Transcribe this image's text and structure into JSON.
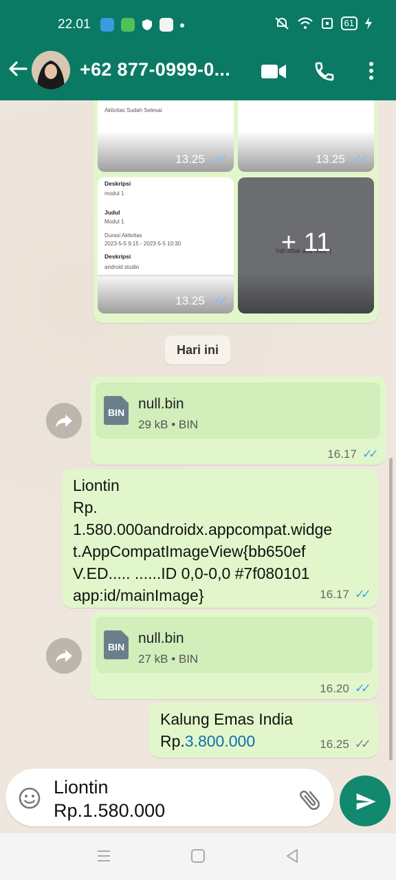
{
  "status_bar": {
    "time": "22.01",
    "battery": "61"
  },
  "header": {
    "contact_name": "+62 877-0999-0..."
  },
  "image_grid": {
    "thumbs": [
      {
        "time": "13.25",
        "caption": "Aktivitas Sudah Selesai"
      },
      {
        "time": "13.25"
      },
      {
        "time": "13.25",
        "lines": [
          "Deskripsi",
          "modul 1",
          "Judul",
          "Modul 1",
          "Durasi Aktivitas",
          "2023-5-5 9:15  -  2023-5-5 10:30",
          "Deskripsi",
          "android studio"
        ]
      },
      {
        "more": "+ 11",
        "underlay": "Yah tidak ada data :("
      }
    ]
  },
  "day_chip": "Hari ini",
  "messages": [
    {
      "type": "document",
      "name": "null.bin",
      "info": "29 kB • BIN",
      "icon_label": "BIN",
      "time": "16.17",
      "ticks": "read"
    },
    {
      "type": "text",
      "lines": [
        "Liontin",
        "Rp.",
        "1.580.000androidx.appcompat.widge",
        "t.AppCompatImageView{bb650ef",
        "V.ED..... ......ID 0,0-0,0 #7f080101",
        "app:id/mainImage}"
      ],
      "time": "16.17",
      "ticks": "read"
    },
    {
      "type": "document",
      "name": "null.bin",
      "info": "27 kB • BIN",
      "icon_label": "BIN",
      "time": "16.20",
      "ticks": "read"
    },
    {
      "type": "text",
      "line1": "Kalung Emas India",
      "price_prefix": "Rp.",
      "price_link": "3.800.000",
      "time": "16.25",
      "ticks": "delivered"
    }
  ],
  "composer": {
    "line1": "Liontin",
    "line2": "Rp.1.580.000"
  },
  "colors": {
    "header": "#0a7a64",
    "bubble_out": "#e1f7cb",
    "send": "#12896f",
    "read_ticks": "#4fa3e0"
  }
}
